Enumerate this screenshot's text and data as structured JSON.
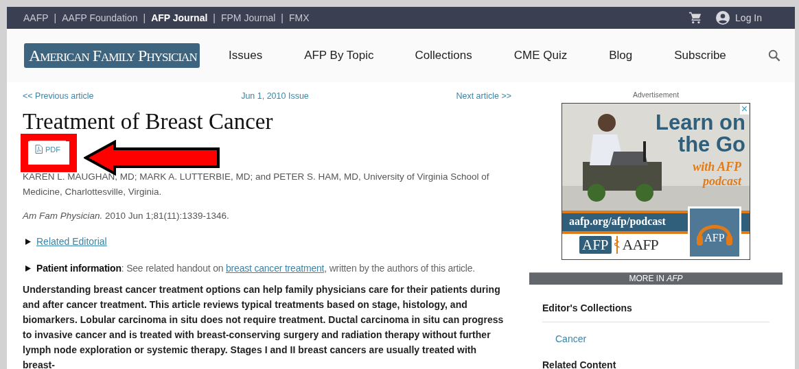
{
  "top_bar": {
    "links": [
      {
        "label": "AAFP",
        "selected": false
      },
      {
        "label": "AAFP Foundation",
        "selected": false
      },
      {
        "label": "AFP Journal",
        "selected": true
      },
      {
        "label": "FPM Journal",
        "selected": false
      },
      {
        "label": "FMX",
        "selected": false
      }
    ],
    "separator": "|",
    "login": "Log In"
  },
  "header": {
    "logo": "American Family Physician",
    "nav": [
      "Issues",
      "AFP By Topic",
      "Collections",
      "CME Quiz",
      "Blog",
      "Subscribe"
    ]
  },
  "article_nav": {
    "previous": "<< Previous article",
    "issue": "Jun 1, 2010 Issue",
    "next": "Next article >>"
  },
  "article": {
    "title": "Treatment of Breast Cancer",
    "pdf_button": "PDF",
    "authors": "KAREN L. MAUGHAN, MD; MARK A. LUTTERBIE, MD; and PETER S. HAM, MD, University of Virginia School of Medicine, Charlottesville, Virginia.",
    "citation": "*Am Fam Physician.* 2010 Jun 1;81(11):1339-1346.",
    "related": [
      {
        "kind": "link",
        "link": "Related Editorial"
      },
      {
        "kind": "info",
        "label": "Patient information",
        "before": ": See related handout on ",
        "link": "breast cancer treatment",
        "after": ", written by the authors of this article."
      }
    ],
    "abstract": "Understanding breast cancer treatment options can help family physicians care for their patients during and after cancer treatment. This article reviews typical treatments based on stage, histology, and biomarkers. Lobular carcinoma in situ does not require treatment. Ductal carcinoma in situ can progress to invasive cancer and is treated with breast-conserving surgery and radiation therapy without further lymph node exploration or systemic therapy. Stages I and II breast cancers are usually treated with breast-"
  },
  "sidebar": {
    "ad_label": "Advertisement",
    "ad": {
      "close": "×",
      "headline": "Learn on the Go",
      "tagline": "with AFP podcast",
      "url": "aafp.org/afp/podcast",
      "logo_left": "AFP",
      "logo_org": "AAFP",
      "badge": "AFP"
    },
    "more_bar": "MORE IN *AFP*",
    "sections": [
      {
        "heading": "Editor's Collections",
        "links": [
          "Cancer"
        ]
      },
      {
        "heading": "Related Content"
      }
    ]
  }
}
